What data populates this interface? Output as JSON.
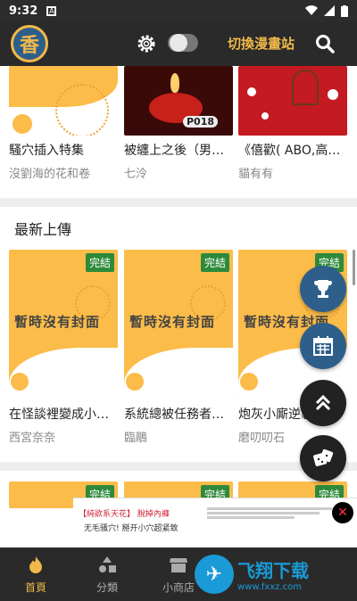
{
  "status": {
    "time": "9:32",
    "notif_icon": "A"
  },
  "appbar": {
    "logo_text": "香",
    "switch_label": "切換漫畫站"
  },
  "top_row": [
    {
      "title": "騷穴插入特集",
      "author": "沒劉海的花和卷"
    },
    {
      "title": "被纏上之後（男男...",
      "author": "七泠"
    },
    {
      "title": "《僖歡( ABO,高H,...",
      "author": "貓有有"
    }
  ],
  "section": {
    "latest_title": "最新上傳"
  },
  "latest": [
    {
      "title": "在怪談裡變成小狼...",
      "author": "西宮奈奈",
      "badge": "完結",
      "cover_text": "暫時沒有封面"
    },
    {
      "title": "系統總被任務者看...",
      "author": "臨鵰",
      "badge": "完結",
      "cover_text": "暫時沒有封面"
    },
    {
      "title": "炮灰小廝逆襲...",
      "author": "磨叨叨石",
      "badge": "完結",
      "cover_text": "暫時沒有封面"
    }
  ],
  "bottom_badges": [
    "完結",
    "完結",
    "完結"
  ],
  "ad": {
    "line1": "【純欲系天花】 脫掉內褲",
    "line2": "无毛骚穴! 掰开小穴超紧致"
  },
  "nav": [
    {
      "label": "首頁",
      "active": true
    },
    {
      "label": "分類",
      "active": false
    },
    {
      "label": "小商店",
      "active": false
    },
    {
      "label": "",
      "active": false
    },
    {
      "label": "",
      "active": false
    }
  ],
  "watermark": {
    "name": "飞翔下载",
    "url": "www.fxxz.com"
  },
  "colors": {
    "accent": "#f0b84a",
    "cover": "#fbbc4a",
    "fab_blue": "#2d5f8a"
  }
}
